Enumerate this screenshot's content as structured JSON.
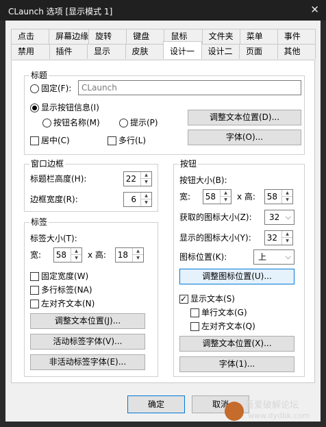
{
  "window": {
    "title": "CLaunch 选项 [显示模式 1]",
    "close_glyph": "✕"
  },
  "tabs": {
    "row1": [
      "点击",
      "屏幕边缘",
      "旋转",
      "键盘",
      "鼠标",
      "文件夹",
      "菜单",
      "事件"
    ],
    "row2": [
      "禁用",
      "插件",
      "显示",
      "皮肤",
      "设计一",
      "设计二",
      "页面",
      "其他"
    ],
    "active": "设计一"
  },
  "title_group": {
    "label": "标题",
    "fixed_label": "固定(F):",
    "fixed_value": "CLaunch",
    "show_button_info_label": "显示按钮信息(I)",
    "button_name_label": "按钮名称(M)",
    "tip_label": "提示(P)",
    "center_label": "居中(C)",
    "multiline_label": "多行(L)",
    "adjust_text_pos_btn": "调整文本位置(D)...",
    "font_btn": "字体(O)..."
  },
  "window_border_group": {
    "label": "窗口边框",
    "titlebar_height_label": "标题栏高度(H):",
    "titlebar_height_value": "22",
    "border_width_label": "边框宽度(R):",
    "border_width_value": "6"
  },
  "tab_group": {
    "label": "标签",
    "tab_size_label": "标签大小(T):",
    "width_label": "宽:",
    "width_value": "58",
    "height_label": "x 高:",
    "height_value": "18",
    "fixed_width_label": "固定宽度(W)",
    "multi_tab_label": "多行标签(NA)",
    "left_align_label": "左对齐文本(N)",
    "adjust_text_pos_btn": "调整文本位置(J)...",
    "active_font_btn": "活动标签字体(V)...",
    "inactive_font_btn": "非活动标签字体(E)..."
  },
  "button_group": {
    "label": "按钮",
    "button_size_label": "按钮大小(B):",
    "width_label": "宽:",
    "width_value": "58",
    "height_label": "x 高:",
    "height_value": "58",
    "fetched_icon_size_label": "获取的图标大小(Z):",
    "fetched_icon_size_value": "32",
    "shown_icon_size_label": "显示的图标大小(Y):",
    "shown_icon_size_value": "32",
    "icon_pos_label": "图标位置(K):",
    "icon_pos_value": "上",
    "adjust_icon_pos_btn": "调整图标位置(U)...",
    "show_text_label": "显示文本(S)",
    "single_line_label": "单行文本(G)",
    "left_align_label": "左对齐文本(Q)",
    "adjust_text_pos_btn": "调整文本位置(X)...",
    "font_btn": "字体(1)..."
  },
  "footer": {
    "ok_label": "确定",
    "cancel_label": "取消"
  },
  "watermark": {
    "line1": "吾爱破解论坛",
    "line2": "www.dydbk.com"
  }
}
